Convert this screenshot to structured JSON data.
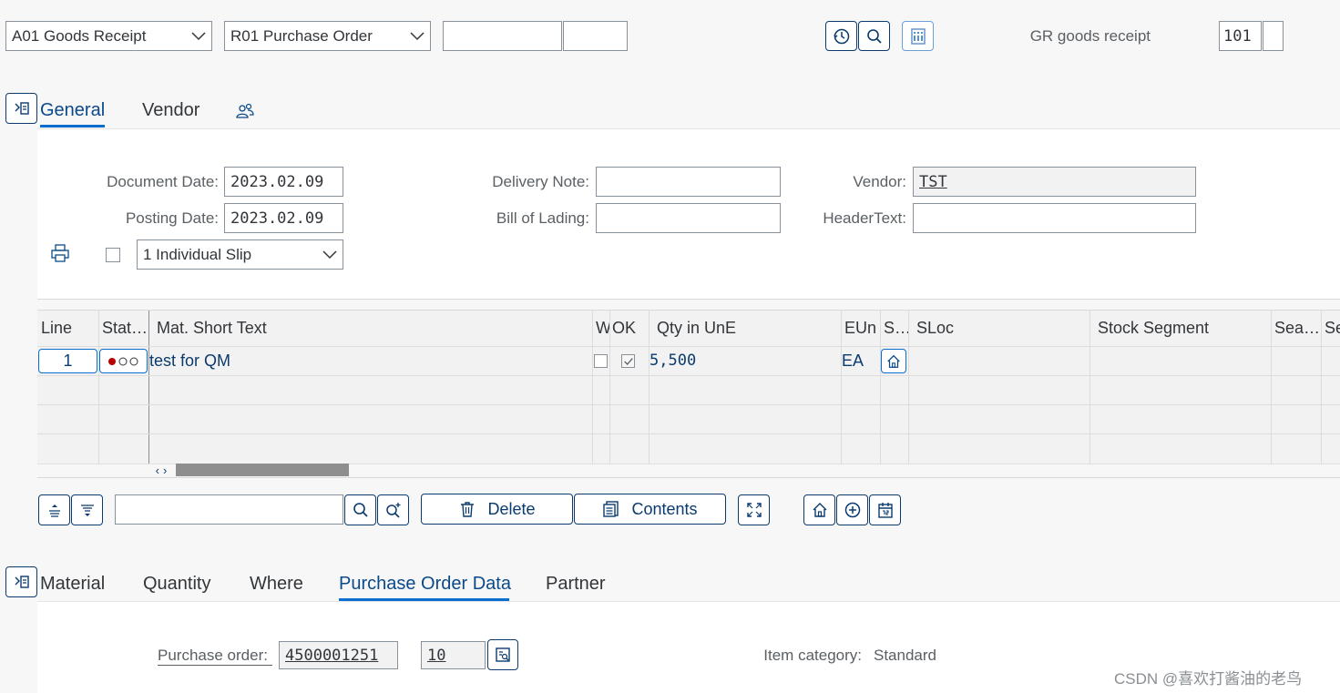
{
  "header": {
    "action_select": "A01 Goods Receipt",
    "reference_select": "R01 Purchase Order",
    "reference_input1": "",
    "reference_input2": "",
    "movement_label": "GR goods receipt",
    "movement_type": "101",
    "movement_extra": ""
  },
  "header_tabs": [
    {
      "label": "General",
      "active": true
    },
    {
      "label": "Vendor",
      "active": false
    }
  ],
  "general": {
    "document_date_label": "Document Date:",
    "document_date": "2023.02.09",
    "posting_date_label": "Posting Date:",
    "posting_date": "2023.02.09",
    "slip_select": "1 Individual Slip",
    "delivery_note_label": "Delivery Note:",
    "delivery_note": "",
    "bill_of_lading_label": "Bill of Lading:",
    "bill_of_lading": "",
    "vendor_label": "Vendor:",
    "vendor": "TST",
    "header_text_label": "HeaderText:",
    "header_text": ""
  },
  "table": {
    "columns": [
      "Line",
      "Stat…",
      "Mat. Short Text",
      "W",
      "OK",
      "Qty in UnE",
      "EUn",
      "S…",
      "SLoc",
      "Stock Segment",
      "Sea…",
      "Se"
    ],
    "rows": [
      {
        "line": "1",
        "status": "red-grey-grey",
        "text": "test for QM",
        "w_checked": false,
        "ok_checked": true,
        "qty": "5,500",
        "eun": "EA",
        "sloc": "",
        "stock_segment": ""
      }
    ]
  },
  "toolbar": {
    "search_value": "",
    "delete_label": "Delete",
    "contents_label": "Contents"
  },
  "item_tabs": [
    {
      "label": "Material",
      "active": false
    },
    {
      "label": "Quantity",
      "active": false
    },
    {
      "label": "Where",
      "active": false
    },
    {
      "label": "Purchase Order Data",
      "active": true
    },
    {
      "label": "Partner",
      "active": false
    }
  ],
  "po_data": {
    "po_label": "Purchase order:",
    "po_number": "4500001251",
    "po_item": "10",
    "item_category_label": "Item category:",
    "item_category": "Standard"
  },
  "watermark": "CSDN @喜欢打酱油的老鸟",
  "colors": {
    "accent": "#0a6ed1",
    "dark_accent": "#0b3b6e",
    "status_red": "#bb0000"
  }
}
